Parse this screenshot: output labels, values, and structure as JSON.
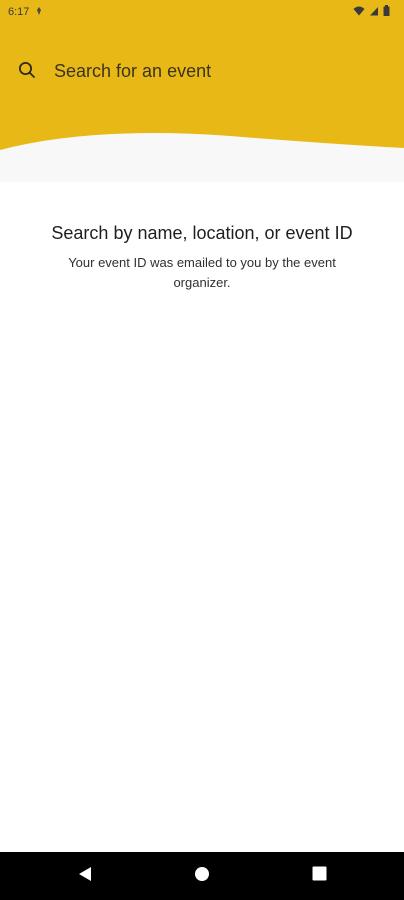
{
  "status_bar": {
    "time": "6:17"
  },
  "search": {
    "placeholder": "Search for an event"
  },
  "empty_state": {
    "title": "Search by name, location, or event ID",
    "description": "Your event ID was emailed to you by the event organizer."
  },
  "icons": {
    "search": "search-icon",
    "back": "nav-back-icon",
    "home": "nav-home-icon",
    "recents": "nav-recents-icon"
  },
  "colors": {
    "header_yellow": "#e8b916",
    "wave_band": "#f8f8f8",
    "background": "#ffffff",
    "nav_bar": "#000000"
  }
}
